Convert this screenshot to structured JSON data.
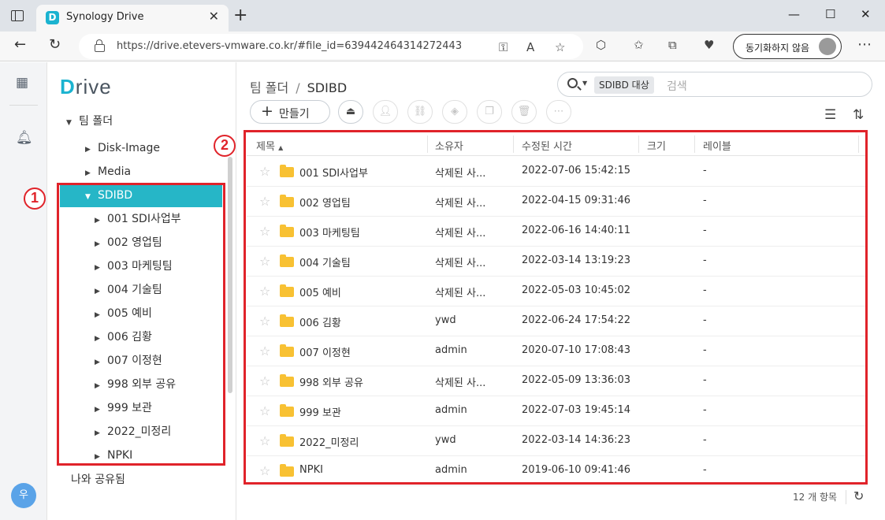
{
  "browser": {
    "tab_title": "Synology Drive",
    "tab_logo": "D",
    "url": "https://drive.etevers-vmware.co.kr/#file_id=639442464314272443",
    "sync_label": "동기화하지 않음",
    "icons": [
      "window-icon",
      "close-icon",
      "new-tab-icon",
      "minimize-icon",
      "maximize-icon",
      "back-icon",
      "refresh-icon",
      "lock-icon",
      "key-icon",
      "read-aloud-icon",
      "favorite-add-icon",
      "extensions-icon",
      "favorites-icon",
      "collections-icon",
      "health-icon",
      "more-icon"
    ]
  },
  "rail": {
    "avatar_letter": "우"
  },
  "tree": {
    "brand_d": "D",
    "brand_rest": "rive",
    "root_label": "팀 폴더",
    "items": [
      {
        "label": "Disk-Image"
      },
      {
        "label": "Media"
      },
      {
        "label": "SDIBD"
      },
      {
        "label": "001 SDI사업부"
      },
      {
        "label": "002 영업팀"
      },
      {
        "label": "003 마케팅팀"
      },
      {
        "label": "004 기술팀"
      },
      {
        "label": "005 예비"
      },
      {
        "label": "006 김황"
      },
      {
        "label": "007 이정현"
      },
      {
        "label": "998 외부 공유"
      },
      {
        "label": "999 보관"
      },
      {
        "label": "2022_미정리"
      },
      {
        "label": "NPKI"
      }
    ],
    "shared_label": "나와 공유됨"
  },
  "annotations": {
    "marker1": "1",
    "marker2": "2"
  },
  "main": {
    "breadcrumb_root": "팀 폴더",
    "breadcrumb_sep": "/",
    "breadcrumb_current": "SDIBD",
    "search_scope": "SDIBD 대상",
    "search_placeholder": "검색",
    "create_label": "만들기",
    "columns": {
      "name": "제목",
      "owner": "소유자",
      "modified": "수정된 시간",
      "size": "크기",
      "label": "레이블"
    },
    "rows": [
      {
        "name": "001 SDI사업부",
        "owner": "삭제된 사...",
        "modified": "2022-07-06 15:42:15",
        "label": "-"
      },
      {
        "name": "002 영업팀",
        "owner": "삭제된 사...",
        "modified": "2022-04-15 09:31:46",
        "label": "-"
      },
      {
        "name": "003 마케팅팀",
        "owner": "삭제된 사...",
        "modified": "2022-06-16 14:40:11",
        "label": "-"
      },
      {
        "name": "004 기술팀",
        "owner": "삭제된 사...",
        "modified": "2022-03-14 13:19:23",
        "label": "-"
      },
      {
        "name": "005 예비",
        "owner": "삭제된 사...",
        "modified": "2022-05-03 10:45:02",
        "label": "-"
      },
      {
        "name": "006 김황",
        "owner": "ywd",
        "modified": "2022-06-24 17:54:22",
        "label": "-"
      },
      {
        "name": "007 이정현",
        "owner": "admin",
        "modified": "2020-07-10 17:08:43",
        "label": "-"
      },
      {
        "name": "998 외부 공유",
        "owner": "삭제된 사...",
        "modified": "2022-05-09 13:36:03",
        "label": "-"
      },
      {
        "name": "999 보관",
        "owner": "admin",
        "modified": "2022-07-03 19:45:14",
        "label": "-"
      },
      {
        "name": "2022_미정리",
        "owner": "ywd",
        "modified": "2022-03-14 14:36:23",
        "label": "-"
      },
      {
        "name": "NPKI",
        "owner": "admin",
        "modified": "2019-06-10 09:41:46",
        "label": "-"
      }
    ],
    "item_count": "12 개 항목"
  },
  "colors": {
    "accent": "#26b6c7",
    "annotation_red": "#e0232a",
    "folder": "#f8c133"
  }
}
